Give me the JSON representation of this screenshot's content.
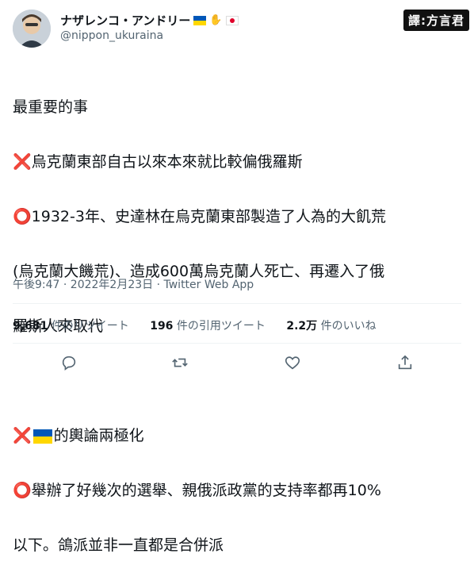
{
  "header": {
    "display_name": "ナザレンコ・アンドリー",
    "handle": "@nippon_ukuraina",
    "name_emojis": [
      "ukraine-flag",
      "handshake",
      "japan-flag"
    ]
  },
  "watermark": "譯:方言君",
  "tweet": {
    "lines": [
      {
        "marker": "",
        "text": "最重要的事"
      },
      {
        "marker": "❌",
        "text": "烏克蘭東部自古以來本來就比較偏俄羅斯"
      },
      {
        "marker": "⭕",
        "text": "1932-3年、史達林在烏克蘭東部製造了人為的大飢荒"
      },
      {
        "marker": "",
        "text": "(烏克蘭大饑荒)、造成600萬烏克蘭人死亡、再遷入了俄"
      },
      {
        "marker": "",
        "text": "羅斯人來取代"
      },
      {
        "marker": "",
        "text": ""
      },
      {
        "marker": "❌",
        "text": "的輿論兩極化",
        "flag": "ukraine-flag"
      },
      {
        "marker": "⭕",
        "text": "舉辦了好幾次的選舉、親俄派政黨的支持率都再10%"
      },
      {
        "marker": "",
        "text": "以下。鴿派並非一直都是合併派"
      }
    ]
  },
  "meta": "午後9:47 · 2022年2月23日 · Twitter Web App",
  "stats": {
    "retweets_count": "9,681",
    "retweets_label": "件のリツイート",
    "quotes_count": "196",
    "quotes_label": "件の引用ツイート",
    "likes_count": "2.2万",
    "likes_label": "件のいいね"
  },
  "actions": [
    "reply-icon",
    "retweet-icon",
    "like-icon",
    "share-icon"
  ],
  "colors": {
    "accent_red": "#e0245e",
    "muted": "#536471",
    "text": "#0f1419"
  }
}
